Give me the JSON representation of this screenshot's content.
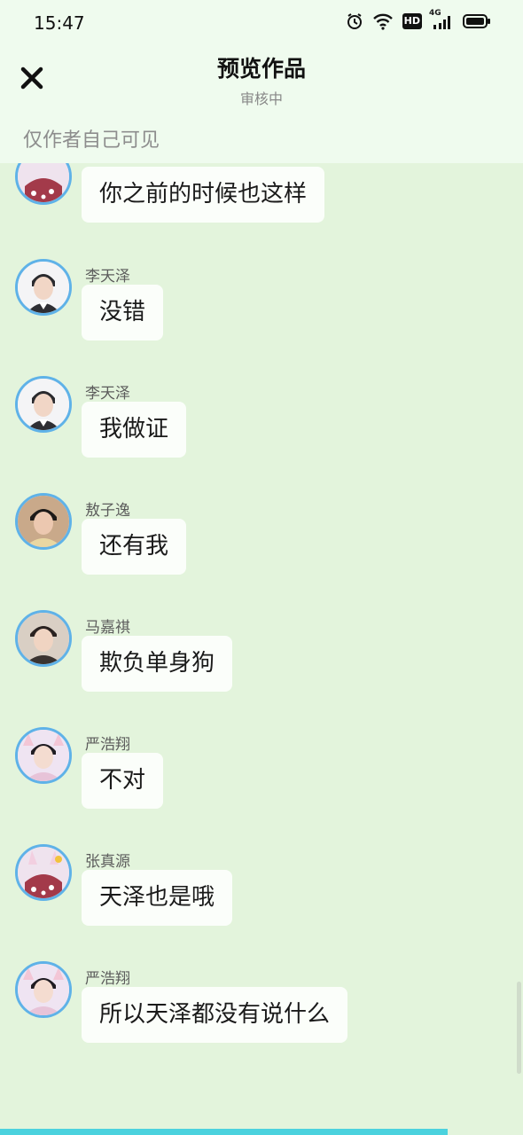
{
  "status_bar": {
    "time": "15:47",
    "icons": [
      "alarm-icon",
      "wifi-icon",
      "hd-icon",
      "signal-4g-icon",
      "battery-icon"
    ],
    "network": "4G",
    "hd": "HD"
  },
  "header": {
    "title": "预览作品",
    "subtitle": "审核中",
    "visibility": "仅作者自己可见",
    "close_icon": "close-icon"
  },
  "colors": {
    "background": "#e3f4dc",
    "header_bg": "#effbee",
    "avatar_border": "#5fb2e8",
    "bubble_bg": "#fbfefa",
    "progress": "#4bd2de"
  },
  "messages": [
    {
      "name": "",
      "text": "你之前的时候也这样",
      "avatar": "bunny-hat-avatar"
    },
    {
      "name": "李天泽",
      "text": "没错",
      "avatar": "li-tianze-avatar"
    },
    {
      "name": "李天泽",
      "text": "我做证",
      "avatar": "li-tianze-avatar"
    },
    {
      "name": "敖子逸",
      "text": "还有我",
      "avatar": "ao-ziyi-avatar"
    },
    {
      "name": "马嘉祺",
      "text": "欺负单身狗",
      "avatar": "ma-jiaqi-avatar"
    },
    {
      "name": "严浩翔",
      "text": "不对",
      "avatar": "yan-haoxiang-avatar"
    },
    {
      "name": "张真源",
      "text": "天泽也是哦",
      "avatar": "zhang-zhenyuan-avatar"
    },
    {
      "name": "严浩翔",
      "text": "所以天泽都没有说什么",
      "avatar": "yan-haoxiang-avatar"
    }
  ]
}
